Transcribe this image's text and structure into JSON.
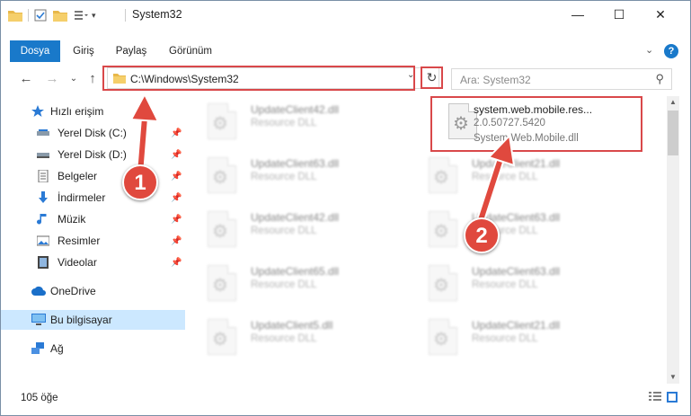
{
  "window": {
    "title": "System32",
    "min_glyph": "—",
    "max_glyph": "☐",
    "close_glyph": "✕"
  },
  "ribbon": {
    "tabs": [
      "Dosya",
      "Giriş",
      "Paylaş",
      "Görünüm"
    ],
    "expand_glyph": "⌄",
    "help_glyph": "?"
  },
  "navigation": {
    "back_glyph": "←",
    "forward_glyph": "→",
    "recent_glyph": "⌄",
    "up_glyph": "↑"
  },
  "address": {
    "path": "C:\\Windows\\System32",
    "refresh_glyph": "↻",
    "dropdown_glyph": "⌄"
  },
  "search": {
    "placeholder": "Ara: System32",
    "icon_glyph": "⚲"
  },
  "sidebar": {
    "quick_access": "Hızlı erişim",
    "items": [
      {
        "label": "Yerel Disk (C:)",
        "icon": "drive-icon"
      },
      {
        "label": "Yerel Disk (D:)",
        "icon": "drive-icon"
      },
      {
        "label": "Belgeler",
        "icon": "documents-icon"
      },
      {
        "label": "İndirmeler",
        "icon": "downloads-icon"
      },
      {
        "label": "Müzik",
        "icon": "music-icon"
      },
      {
        "label": "Resimler",
        "icon": "pictures-icon"
      },
      {
        "label": "Videolar",
        "icon": "videos-icon"
      }
    ],
    "onedrive": "OneDrive",
    "this_pc": "Bu bilgisayar",
    "network": "Ağ"
  },
  "files": {
    "highlighted": {
      "name": "system.web.mobile.res...",
      "version": "2.0.50727.5420",
      "description": "System.Web.Mobile.dll"
    },
    "others": [
      {
        "name": "UpdateClient42.dll",
        "type": "Resource DLL"
      },
      {
        "name": "UpdateClient63.dll",
        "type": "Resource DLL"
      },
      {
        "name": "UpdateClient21.dll",
        "type": "Resource DLL"
      },
      {
        "name": "UpdateClient42.dll",
        "type": "Resource DLL"
      },
      {
        "name": "UpdateClient63.dll",
        "type": "Resource DLL"
      },
      {
        "name": "UpdateClient65.dll",
        "type": "Resource DLL"
      },
      {
        "name": "UpdateClient63.dll",
        "type": "Resource DLL"
      },
      {
        "name": "UpdateClient5.dll",
        "type": "Resource DLL"
      },
      {
        "name": "UpdateClient21.dll",
        "type": "Resource DLL"
      }
    ]
  },
  "status": {
    "item_count": "105 öğe"
  },
  "annotations": {
    "step1": "1",
    "step2": "2",
    "color": "#d9484a"
  }
}
